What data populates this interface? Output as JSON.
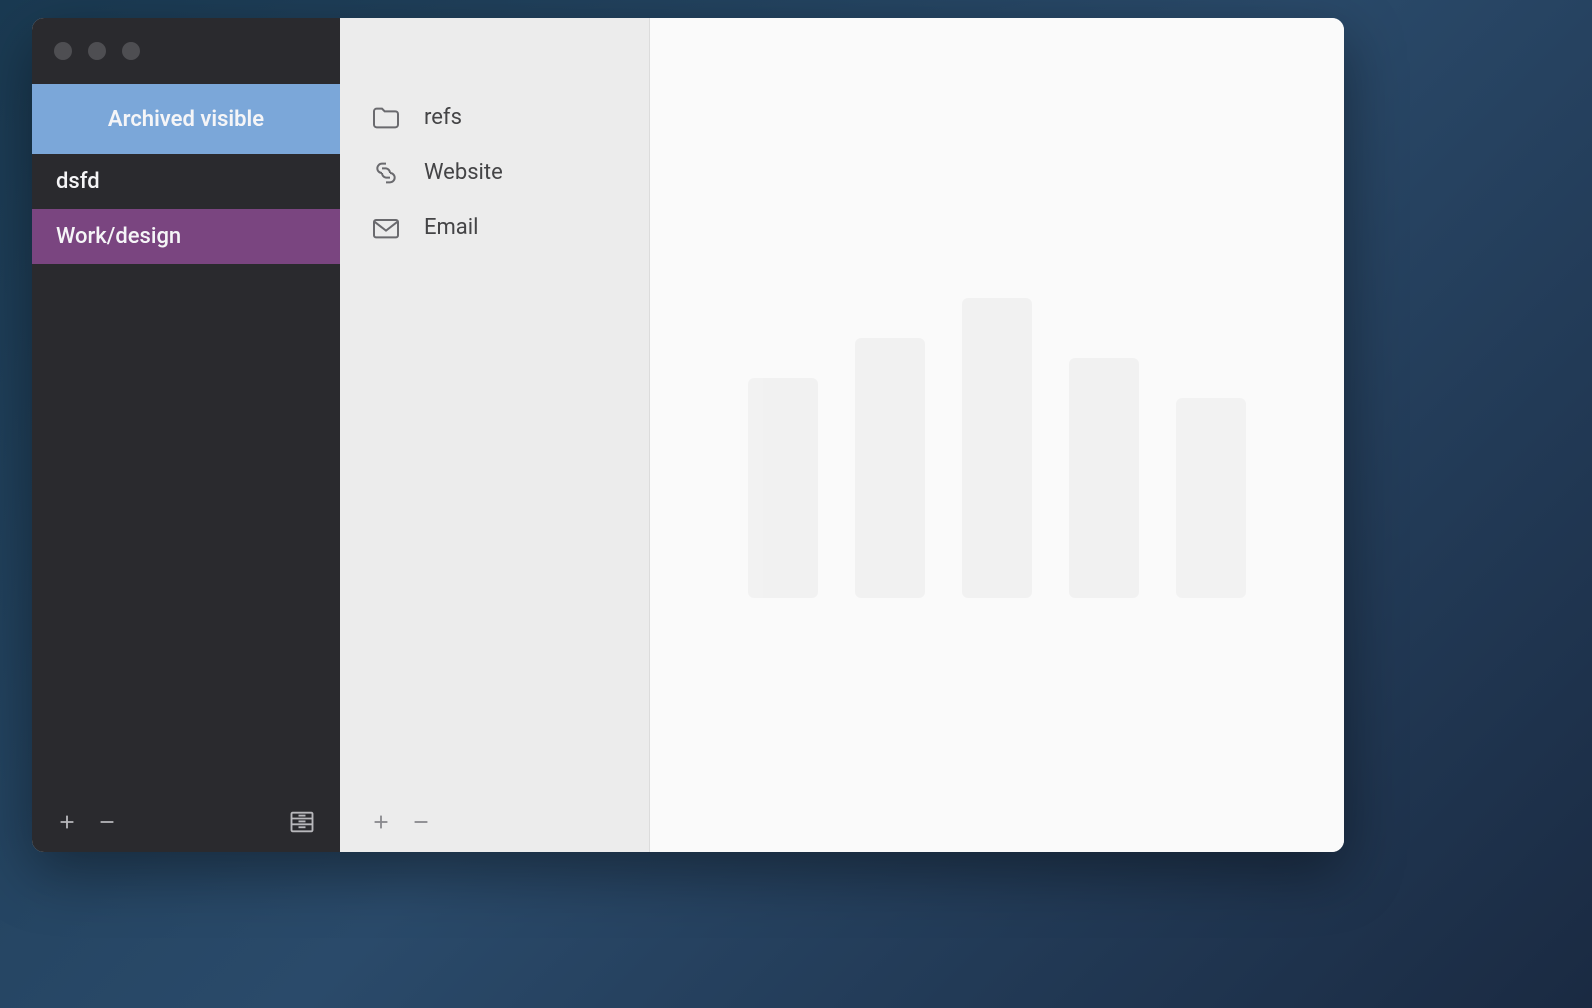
{
  "sidebar": {
    "header": "Archived visible",
    "items": [
      {
        "label": "dsfd",
        "selected": false
      },
      {
        "label": "Work/design",
        "selected": true
      }
    ]
  },
  "middle": {
    "items": [
      {
        "icon": "folder-icon",
        "label": "refs"
      },
      {
        "icon": "link-icon",
        "label": "Website"
      },
      {
        "icon": "envelope-icon",
        "label": "Email"
      }
    ]
  },
  "colors": {
    "sidebar_bg": "#2a2a2e",
    "header_bg": "#7ba7d9",
    "selected_bg": "#7a4580",
    "middle_bg": "#ececec",
    "content_bg": "#fafafa"
  }
}
